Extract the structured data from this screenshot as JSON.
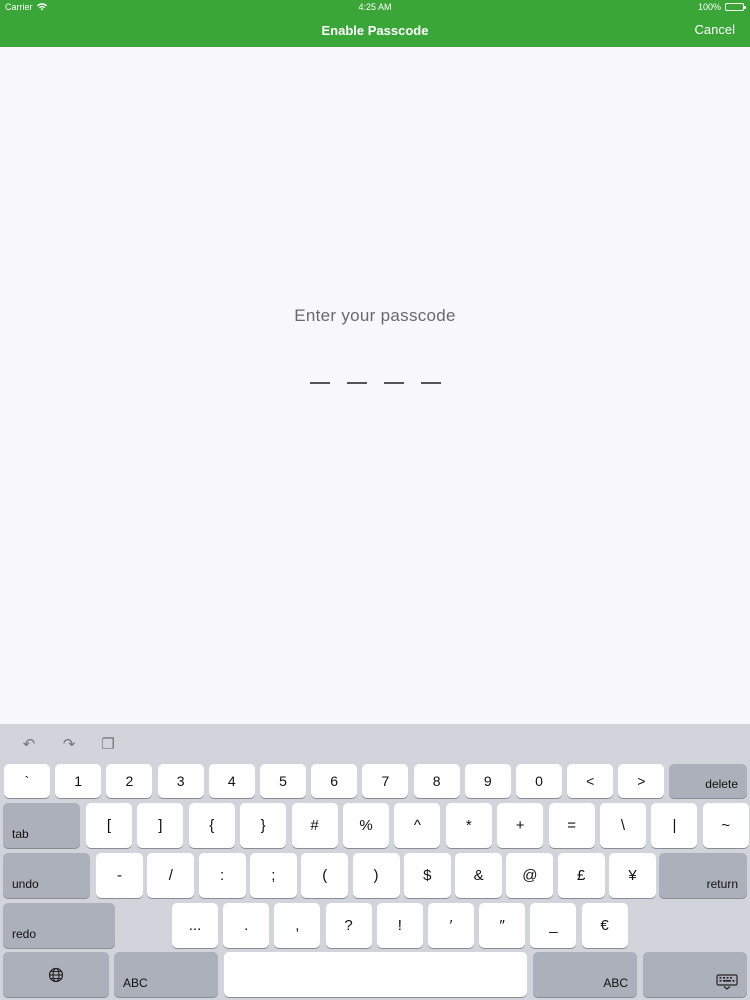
{
  "theme": {
    "accent": "#3aa638"
  },
  "status_bar": {
    "carrier": "Carrier",
    "time": "4:25 AM",
    "battery": "100%"
  },
  "nav": {
    "title": "Enable Passcode",
    "cancel_label": "Cancel"
  },
  "passcode": {
    "prompt": "Enter your passcode",
    "slot_count": 4
  },
  "keyboard": {
    "toolbar": [
      {
        "name": "undo-icon",
        "glyph": "↶"
      },
      {
        "name": "redo-icon",
        "glyph": "↷"
      },
      {
        "name": "paste-icon",
        "glyph": "❐"
      }
    ],
    "row1": [
      "`",
      "1",
      "2",
      "3",
      "4",
      "5",
      "6",
      "7",
      "8",
      "9",
      "0",
      "<",
      ">"
    ],
    "row1_end": "delete",
    "row2_start": "tab",
    "row2": [
      "[",
      "]",
      "{",
      "}",
      "#",
      "%",
      "^",
      "*",
      "+",
      "=",
      "\\",
      "|",
      "~"
    ],
    "row3_start": "undo",
    "row3": [
      "-",
      "/",
      ":",
      ";",
      "(",
      ")",
      "$",
      "&",
      "@",
      "£",
      "¥"
    ],
    "row3_end": "return",
    "row4_start": "redo",
    "row4": [
      "...",
      ".",
      ",",
      "?",
      "!",
      "′",
      "″",
      "_",
      "€"
    ],
    "row5": {
      "abc_left": "ABC",
      "abc_right": "ABC"
    }
  }
}
